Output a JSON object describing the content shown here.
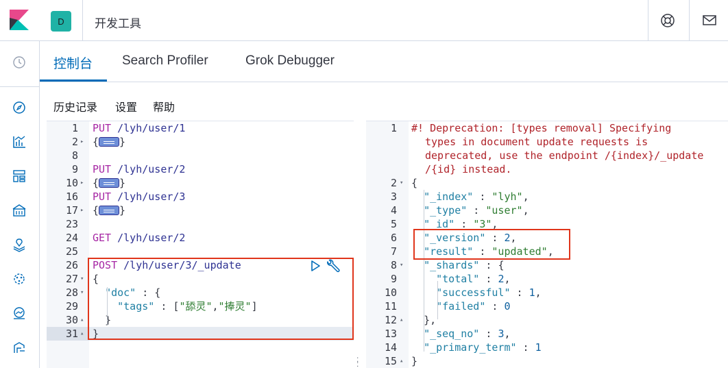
{
  "header": {
    "space_initial": "D",
    "app_title": "开发工具",
    "colors": {
      "space_badge": "#20b2a6",
      "accent": "#006bb8",
      "highlight": "#e0351b"
    }
  },
  "nav": {
    "icons": [
      "clock-icon",
      "compass-icon",
      "visualize-icon",
      "dashboard-icon",
      "canvas-icon",
      "maps-icon",
      "ml-icon",
      "metrics-icon",
      "logs-icon"
    ]
  },
  "tabs": [
    {
      "label": "控制台",
      "active": true
    },
    {
      "label": "Search Profiler",
      "active": false
    },
    {
      "label": "Grok Debugger",
      "active": false
    }
  ],
  "toolbar": {
    "history": "历史记录",
    "settings": "设置",
    "help": "帮助"
  },
  "request_editor": {
    "lines": [
      {
        "n": "1",
        "fold": "",
        "method": "PUT",
        "url": "/lyh/user/1"
      },
      {
        "n": "2",
        "fold": "▸",
        "text": "{",
        "collapsed": true,
        "close": "}"
      },
      {
        "n": "8",
        "fold": "",
        "text": ""
      },
      {
        "n": "9",
        "fold": "",
        "method": "PUT",
        "url": "/lyh/user/2"
      },
      {
        "n": "10",
        "fold": "▸",
        "text": "{",
        "collapsed": true,
        "close": "}"
      },
      {
        "n": "16",
        "fold": "",
        "method": "PUT",
        "url": "/lyh/user/3"
      },
      {
        "n": "17",
        "fold": "▸",
        "text": "{",
        "collapsed": true,
        "close": "}"
      },
      {
        "n": "23",
        "fold": "",
        "text": ""
      },
      {
        "n": "24",
        "fold": "",
        "method": "GET",
        "url": "/lyh/user/2"
      },
      {
        "n": "25",
        "fold": "",
        "text": ""
      },
      {
        "n": "26",
        "fold": "",
        "method": "POST",
        "url": "/lyh/user/3/_update"
      },
      {
        "n": "27",
        "fold": "▾",
        "text": "{"
      },
      {
        "n": "28",
        "fold": "▾",
        "key": "\"doc\"",
        "rest": " : {",
        "indent": 1
      },
      {
        "n": "29",
        "fold": "",
        "key": "\"tags\"",
        "mid": " : [",
        "s1": "\"舔灵\"",
        "sep": ",",
        "s2": "\"捧灵\"",
        "end": "]",
        "indent": 2
      },
      {
        "n": "30",
        "fold": "▴",
        "text": "}",
        "indent": 1
      },
      {
        "n": "31",
        "fold": "▴",
        "text": "}",
        "selected": true
      }
    ]
  },
  "response_editor": {
    "warning": [
      "#! Deprecation: [types removal] Specifying",
      "types in document update requests is",
      "deprecated, use the endpoint /{index}/_update",
      "/{id} instead."
    ],
    "lines": [
      {
        "n": "1",
        "fold": ""
      },
      {
        "n": "2",
        "fold": "▾",
        "text": "{"
      },
      {
        "n": "3",
        "fold": "",
        "key": "\"_index\"",
        "val": "\"lyh\"",
        "type": "str",
        "comma": ",",
        "indent": 1
      },
      {
        "n": "4",
        "fold": "",
        "key": "\"_type\"",
        "val": "\"user\"",
        "type": "str",
        "comma": ",",
        "indent": 1
      },
      {
        "n": "5",
        "fold": "",
        "key": "\"_id\"",
        "val": "\"3\"",
        "type": "str",
        "comma": ",",
        "indent": 1
      },
      {
        "n": "6",
        "fold": "",
        "key": "\"_version\"",
        "val": "2",
        "type": "num",
        "comma": ",",
        "indent": 1
      },
      {
        "n": "7",
        "fold": "",
        "key": "\"result\"",
        "val": "\"updated\"",
        "type": "str",
        "comma": ",",
        "indent": 1
      },
      {
        "n": "8",
        "fold": "▾",
        "key": "\"_shards\"",
        "val": "{",
        "type": "punc",
        "comma": "",
        "indent": 1
      },
      {
        "n": "9",
        "fold": "",
        "key": "\"total\"",
        "val": "2",
        "type": "num",
        "comma": ",",
        "indent": 2
      },
      {
        "n": "10",
        "fold": "",
        "key": "\"successful\"",
        "val": "1",
        "type": "num",
        "comma": ",",
        "indent": 2
      },
      {
        "n": "11",
        "fold": "",
        "key": "\"failed\"",
        "val": "0",
        "type": "num",
        "comma": "",
        "indent": 2
      },
      {
        "n": "12",
        "fold": "▴",
        "text": "},",
        "indent": 1
      },
      {
        "n": "13",
        "fold": "",
        "key": "\"_seq_no\"",
        "val": "3",
        "type": "num",
        "comma": ",",
        "indent": 1
      },
      {
        "n": "14",
        "fold": "",
        "key": "\"_primary_term\"",
        "val": "1",
        "type": "num",
        "comma": "",
        "indent": 1
      },
      {
        "n": "15",
        "fold": "▴",
        "text": "}"
      }
    ]
  }
}
